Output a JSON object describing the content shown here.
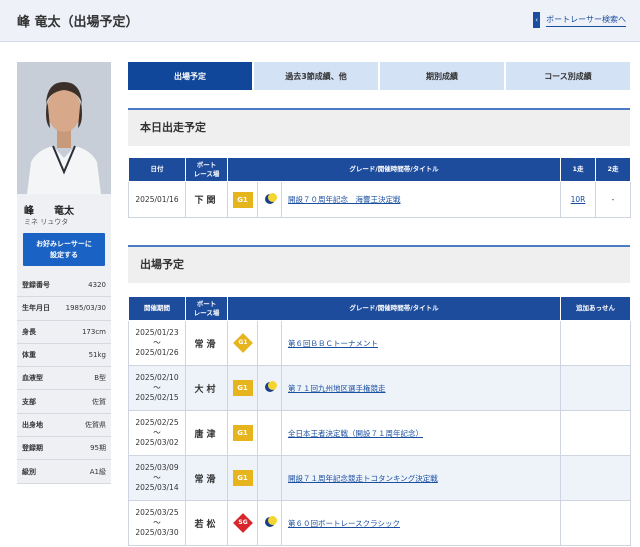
{
  "header": {
    "title": "峰 竜太（出場予定）",
    "search_link": "ボートレーサー検索へ"
  },
  "profile": {
    "name": "峰　　竜太",
    "kana": "ミネ リュウタ",
    "fav_button": "お好みレーサーに\n設定する",
    "info": [
      {
        "k": "登録番号",
        "v": "4320"
      },
      {
        "k": "生年月日",
        "v": "1985/03/30"
      },
      {
        "k": "身長",
        "v": "173cm"
      },
      {
        "k": "体重",
        "v": "51kg"
      },
      {
        "k": "血液型",
        "v": "B型"
      },
      {
        "k": "支部",
        "v": "佐賀"
      },
      {
        "k": "出身地",
        "v": "佐賀県"
      },
      {
        "k": "登録期",
        "v": "95期"
      },
      {
        "k": "級別",
        "v": "A1級"
      }
    ]
  },
  "tabs": [
    "出場予定",
    "過去3節成績、他",
    "期別成績",
    "コース別成績"
  ],
  "today": {
    "heading": "本日出走予定",
    "headers": {
      "date": "日付",
      "venue": "ボート\nレース場",
      "grade": "グレード/開催時間帯/タイトル",
      "r1": "1走",
      "r2": "2走"
    },
    "row": {
      "date": "2025/01/16",
      "venue": "下関",
      "grade": "G1",
      "title": "開設７０周年記念　海響王決定戦",
      "r1": "10R",
      "r2": "-"
    }
  },
  "upcoming": {
    "heading": "出場予定",
    "headers": {
      "period": "開催期間",
      "venue": "ボート\nレース場",
      "grade": "グレード/開催時間帯/タイトル",
      "note": "追加あっせん"
    },
    "tilde": "〜",
    "rows": [
      {
        "start": "2025/01/23",
        "end": "2025/01/26",
        "venue": "常滑",
        "grade": "G1",
        "title": "第６回ＢＢＣトーナメント"
      },
      {
        "start": "2025/02/10",
        "end": "2025/02/15",
        "venue": "大村",
        "grade": "G1",
        "title": "第７１回九州地区選手権競走"
      },
      {
        "start": "2025/02/25",
        "end": "2025/03/02",
        "venue": "唐津",
        "grade": "G1",
        "title": "全日本王者決定戦（開設７１周年記念）"
      },
      {
        "start": "2025/03/09",
        "end": "2025/03/14",
        "venue": "常滑",
        "grade": "G1",
        "title": "開設７１周年記念競走トコタンキング決定戦"
      },
      {
        "start": "2025/03/25",
        "end": "2025/03/30",
        "venue": "若松",
        "grade": "SG",
        "title": "第６０回ボートレースクラシック"
      }
    ]
  }
}
